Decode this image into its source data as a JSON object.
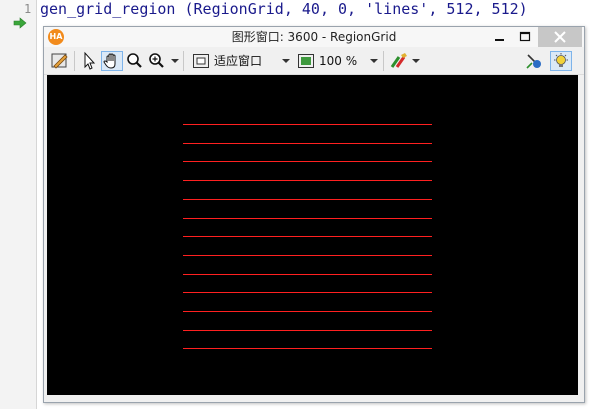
{
  "editor": {
    "line_number": "1",
    "code": "gen_grid_region (RegionGrid, 40, 0, 'lines', 512, 512)"
  },
  "graphics_window": {
    "logo_text": "HA",
    "title": "图形窗口: 3600 - RegionGrid",
    "fit_mode_label": "适应窗口",
    "zoom_label": "100 %",
    "region_color": "#ff2020",
    "region_line_count": 13
  }
}
